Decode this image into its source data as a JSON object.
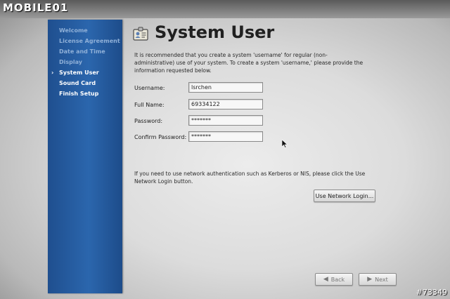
{
  "watermark": "MOBILE01",
  "image_number": "#73349",
  "sidebar": {
    "items": [
      {
        "label": "Welcome",
        "state": "done"
      },
      {
        "label": "License Agreement",
        "state": "done"
      },
      {
        "label": "Date and Time",
        "state": "done"
      },
      {
        "label": "Display",
        "state": "done"
      },
      {
        "label": "System User",
        "state": "current",
        "marker": "›"
      },
      {
        "label": "Sound Card",
        "state": "pending"
      },
      {
        "label": "Finish Setup",
        "state": "pending"
      }
    ]
  },
  "page": {
    "title": "System User",
    "title_icon": "user-id-card-icon",
    "intro": "It is recommended that you create a system 'username' for regular (non-administrative) use of your system. To create a system 'username,' please provide the information requested below."
  },
  "form": {
    "username_label": "Username:",
    "username_value": "lsrchen",
    "fullname_label": "Full Name:",
    "fullname_value": "69334122",
    "password_label": "Password:",
    "password_value": "*******",
    "confirm_label": "Confirm Password:",
    "confirm_value": "*******"
  },
  "network": {
    "info": "If you need to use network authentication such as Kerberos or NIS, please click the Use Network Login button.",
    "button_label": "Use Network Login..."
  },
  "nav": {
    "back_label": "Back",
    "back_icon": "arrow-left-icon",
    "next_label": "Next",
    "next_icon": "arrow-right-icon"
  },
  "colors": {
    "sidebar_blue": "#2b66ad",
    "sidebar_done_text": "#8fb0d8",
    "sidebar_active_text": "#ffffff"
  }
}
